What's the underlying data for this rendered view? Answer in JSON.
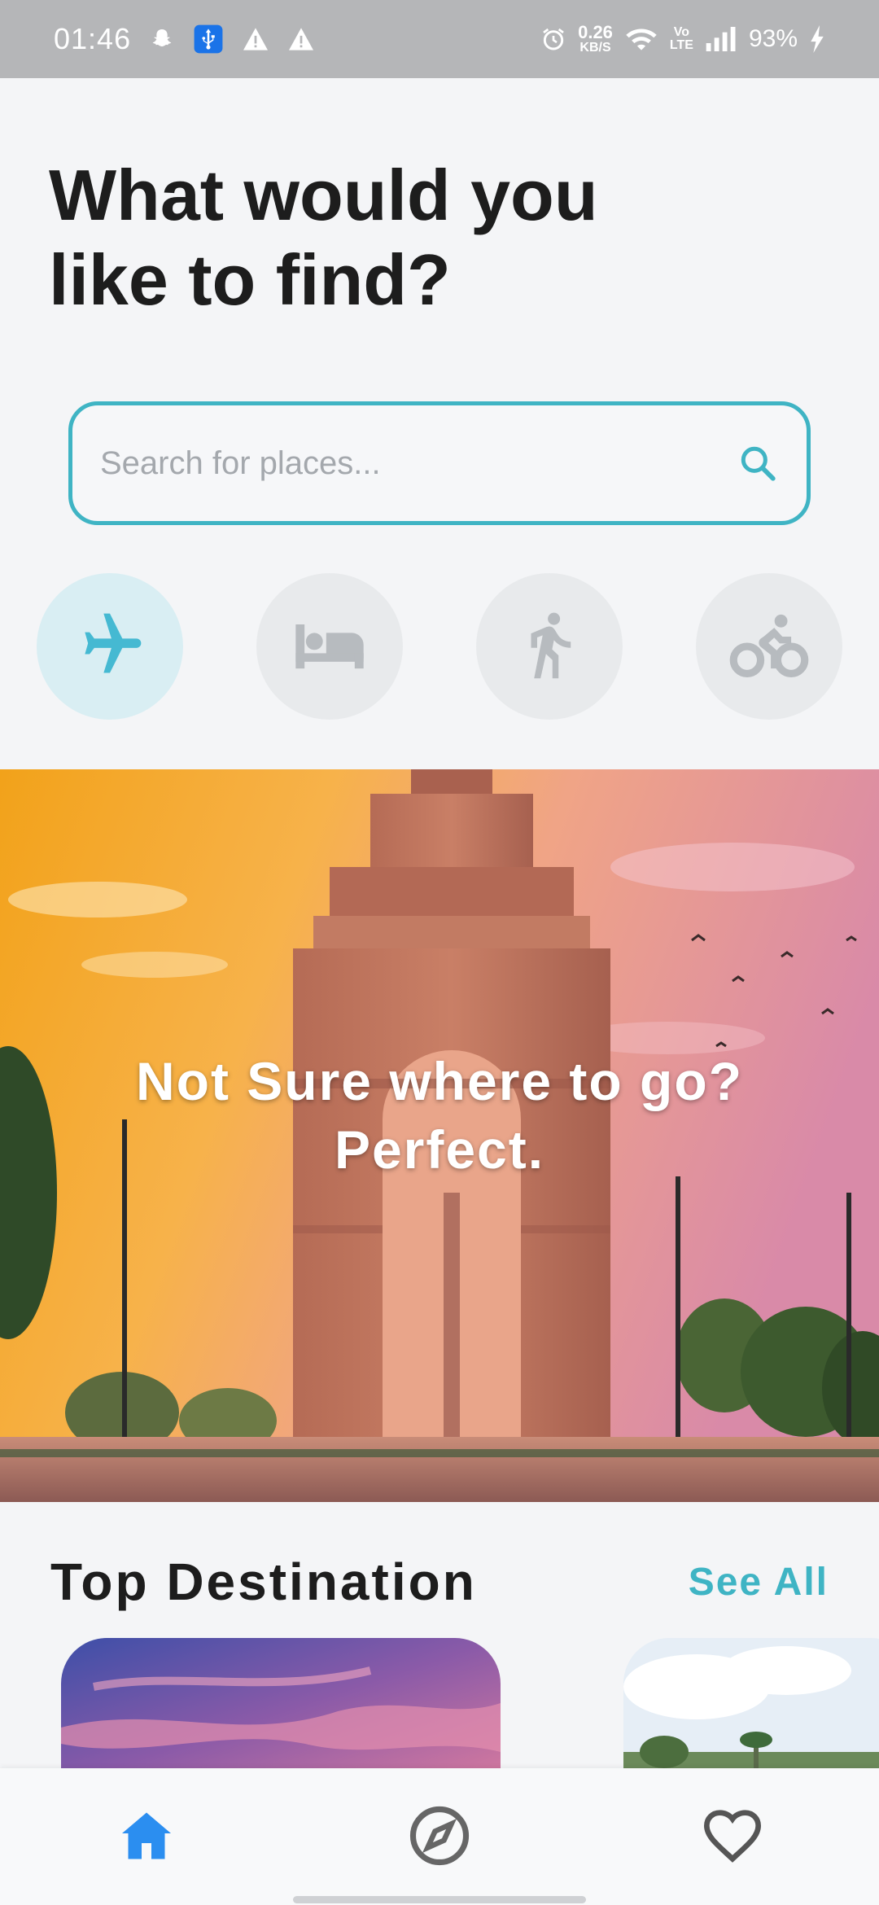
{
  "status_bar": {
    "time": "01:46",
    "net_speed_value": "0.26",
    "net_speed_unit": "KB/S",
    "volte_top": "Vo",
    "volte_bottom": "LTE",
    "battery": "93%",
    "icons": [
      "snapchat-icon",
      "usb-icon",
      "warning-icon",
      "warning-icon",
      "alarm-icon",
      "wifi-icon",
      "signal-icon",
      "charging-icon"
    ]
  },
  "headline": {
    "line1": "What would you",
    "line2": "like to find?"
  },
  "search": {
    "placeholder": "Search for places..."
  },
  "categories": [
    {
      "icon": "airplane-icon",
      "active": true
    },
    {
      "icon": "bed-icon",
      "active": false
    },
    {
      "icon": "walking-icon",
      "active": false
    },
    {
      "icon": "bicycle-icon",
      "active": false
    }
  ],
  "hero": {
    "line1": "Not Sure where to go?",
    "line2": "Perfect."
  },
  "top_destination": {
    "title": "Top Destination",
    "see_all": "See All"
  },
  "bottom_nav": {
    "items": [
      {
        "icon": "home-icon",
        "active": true
      },
      {
        "icon": "compass-icon",
        "active": false
      },
      {
        "icon": "heart-icon",
        "active": false
      }
    ]
  },
  "colors": {
    "accent": "#3fb4c4",
    "nav_active": "#2b8ef0",
    "icon_inactive": "#b7bbbf",
    "status_bar": "#b5b6b8"
  }
}
